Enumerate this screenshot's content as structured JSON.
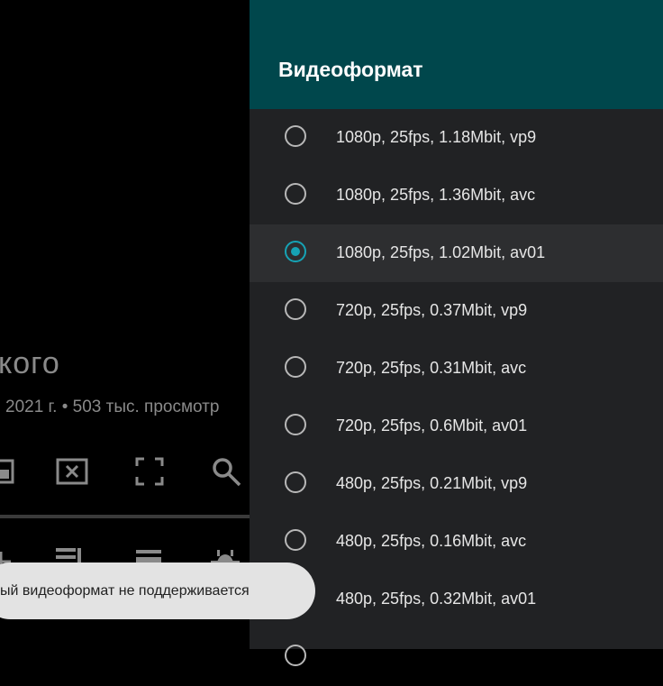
{
  "background": {
    "video_title_fragment": "кого",
    "video_meta_fragment": "2021 г. • 503 тыс. просмотр"
  },
  "dialog": {
    "title": "Видеоформат",
    "options": [
      {
        "label": "1080p, 25fps, 1.18Mbit, vp9",
        "selected": false
      },
      {
        "label": "1080p, 25fps, 1.36Mbit, avc",
        "selected": false
      },
      {
        "label": "1080p, 25fps, 1.02Mbit, av01",
        "selected": true
      },
      {
        "label": "720p, 25fps, 0.37Mbit, vp9",
        "selected": false
      },
      {
        "label": "720p, 25fps, 0.31Mbit, avc",
        "selected": false
      },
      {
        "label": "720p, 25fps, 0.6Mbit, av01",
        "selected": false
      },
      {
        "label": "480p, 25fps, 0.21Mbit, vp9",
        "selected": false
      },
      {
        "label": "480p, 25fps, 0.16Mbit, avc",
        "selected": false
      },
      {
        "label": "480p, 25fps, 0.32Mbit, av01",
        "selected": false
      },
      {
        "label": "",
        "selected": false
      }
    ]
  },
  "toast": {
    "message": "ый видеоформат не поддерживается"
  },
  "colors": {
    "header": "#00474c",
    "dialog_bg": "#212224",
    "accent": "#16a3b5"
  }
}
